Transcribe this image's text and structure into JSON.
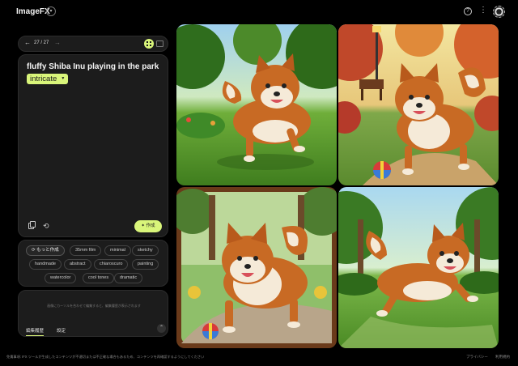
{
  "header": {
    "brand": "ImageFX",
    "help_icon": "help-circle-icon",
    "more_icon": "more-vert-icon",
    "avatar_icon": "account-avatar-icon"
  },
  "nav": {
    "prev_icon": "arrow-left-icon",
    "next_icon": "arrow-right-icon",
    "counter": "27 / 27"
  },
  "prompt": {
    "text": "fluffy Shiba Inu playing in the park",
    "highlight_chip": "intricate",
    "create_button": "✦ 作成"
  },
  "styles": {
    "chips": [
      "もっと作成",
      "35mm film",
      "minimal",
      "sketchy",
      "handmade",
      "abstract",
      "chiaroscuro",
      "painting",
      "watercolor",
      "cool tones",
      "dramatic"
    ]
  },
  "info": {
    "hint": "画像にカーソルを合わせて編集すると、編集履歴が表示されます",
    "tabs": [
      "編集履歴",
      "設定"
    ]
  },
  "footer": {
    "disclaimer": "免責事項: IFX ツールが生成したコンテンツが不適切または不正確な場合もあるため、コンテンツを再確認するようにしてください",
    "privacy": "プライバシー",
    "terms": "利用規約"
  },
  "colors": {
    "accent": "#d9f57a",
    "panel": "#1c1c1c",
    "background": "#000000"
  }
}
